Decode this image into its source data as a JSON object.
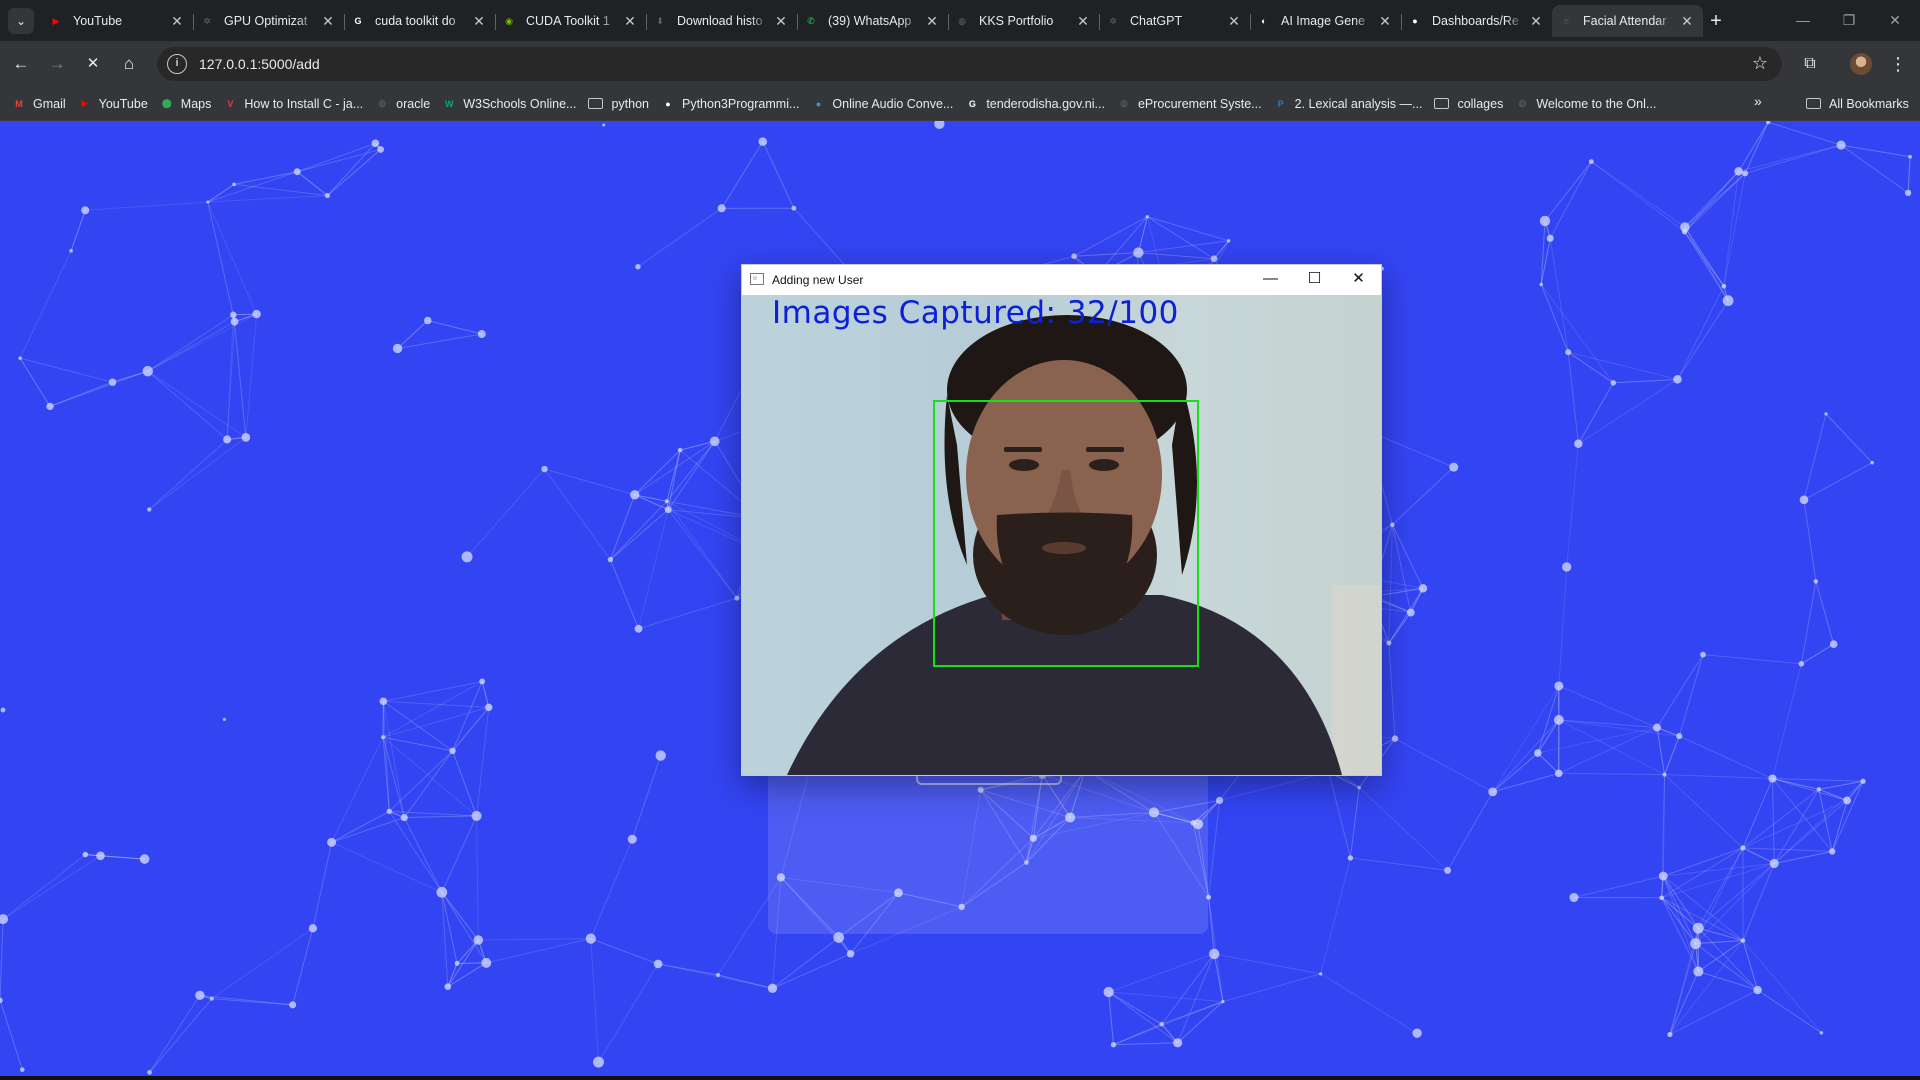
{
  "browser": {
    "tabs": [
      {
        "title": "YouTube",
        "icon": "youtube-icon",
        "color": "#ff0000",
        "glyph": "▶"
      },
      {
        "title": "GPU Optimizat",
        "icon": "openai-icon",
        "color": "#5f6368",
        "glyph": "✲"
      },
      {
        "title": "cuda toolkit do",
        "icon": "google-icon",
        "color": "#ffffff",
        "glyph": "G"
      },
      {
        "title": "CUDA Toolkit 1",
        "icon": "nvidia-icon",
        "color": "#76b900",
        "glyph": "◉"
      },
      {
        "title": "Download histo",
        "icon": "download-icon",
        "color": "#5f6368",
        "glyph": "⬇"
      },
      {
        "title": "(39) WhatsApp",
        "icon": "whatsapp-icon",
        "color": "#25d366",
        "glyph": "✆"
      },
      {
        "title": "KKS Portfolio",
        "icon": "globe-icon",
        "color": "#5f6368",
        "glyph": "◍"
      },
      {
        "title": "ChatGPT",
        "icon": "openai-icon",
        "color": "#5f6368",
        "glyph": "✲"
      },
      {
        "title": "AI Image Gene",
        "icon": "ai-image-icon",
        "color": "#ffffff",
        "glyph": "◐"
      },
      {
        "title": "Dashboards/Re",
        "icon": "github-icon",
        "color": "#ffffff",
        "glyph": "●"
      },
      {
        "title": "Facial Attendar",
        "icon": "loading-spinner-icon",
        "color": "#8ab4f8",
        "glyph": "◌"
      }
    ],
    "active_tab_index": 10,
    "new_tab_glyph": "+",
    "tab_close_glyph": "✕",
    "tab_list_glyph": "⌄",
    "window_controls": {
      "minimize": "—",
      "restore": "❐",
      "close": "✕"
    },
    "nav": {
      "back": "←",
      "forward": "→",
      "stop": "✕",
      "home": "⌂"
    },
    "url": "127.0.0.1:5000/add",
    "site_info_glyph": "i",
    "star_glyph": "☆",
    "extensions_glyph": "⧉",
    "menu_glyph": "⋮",
    "bookmarks": [
      {
        "label": "Gmail",
        "icon": "gmail-icon",
        "color": "#ea4335",
        "glyph": "M"
      },
      {
        "label": "YouTube",
        "icon": "youtube-icon",
        "color": "#ff0000",
        "glyph": "▶"
      },
      {
        "label": "Maps",
        "icon": "maps-icon",
        "color": "#34a853",
        "glyph": "⬤"
      },
      {
        "label": "How to Install C - ja...",
        "icon": "vivaldi-icon",
        "color": "#ef3939",
        "glyph": "V"
      },
      {
        "label": "oracle",
        "icon": "globe-icon",
        "color": "#5f6368",
        "glyph": "◍"
      },
      {
        "label": "W3Schools Online...",
        "icon": "w3schools-icon",
        "color": "#04aa6d",
        "glyph": "W"
      },
      {
        "label": "python",
        "icon": "folder-icon",
        "color": "",
        "glyph": ""
      },
      {
        "label": "Python3Programmi...",
        "icon": "github-icon",
        "color": "#ffffff",
        "glyph": "●"
      },
      {
        "label": "Online Audio Conve...",
        "icon": "audio-converter-icon",
        "color": "#4a90e2",
        "glyph": "●"
      },
      {
        "label": "tenderodisha.gov.ni...",
        "icon": "google-icon",
        "color": "#ffffff",
        "glyph": "G"
      },
      {
        "label": "eProcurement Syste...",
        "icon": "globe-icon",
        "color": "#5f6368",
        "glyph": "◍"
      },
      {
        "label": "2. Lexical analysis —...",
        "icon": "python-icon",
        "color": "#3776ab",
        "glyph": "P"
      },
      {
        "label": "collages",
        "icon": "folder-icon",
        "color": "",
        "glyph": ""
      },
      {
        "label": "Welcome to the Onl...",
        "icon": "globe-icon",
        "color": "#5f6368",
        "glyph": "◍"
      }
    ],
    "bookmarks_more_glyph": "»",
    "all_bookmarks_label": "All Bookmarks"
  },
  "page": {
    "background_color": "#3344f2"
  },
  "cv_window": {
    "title": "Adding new User",
    "controls": {
      "minimize": "—",
      "maximize": "☐",
      "close": "✕"
    },
    "overlay_text": "Images Captured: 32/100",
    "overlay_color": "#0c20d8",
    "face_box_color": "#18e018"
  }
}
